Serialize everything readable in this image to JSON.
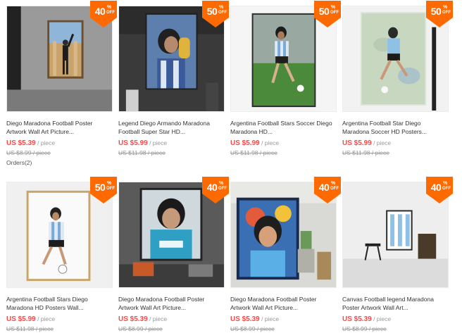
{
  "colors": {
    "accent": "#ff4747",
    "badge": "#ff6a00",
    "muted": "#999999"
  },
  "products": [
    {
      "discount": "40",
      "pct": "%",
      "off": "OFF",
      "title": "Diego Maradona Football Poster Artwork Wall Art Picture...",
      "price": "US $5.39",
      "unit": " / piece",
      "old_price": "US $8.99",
      "old_unit": " / piece",
      "orders": "Orders(2)"
    },
    {
      "discount": "50",
      "pct": "%",
      "off": "OFF",
      "title": "Legend Diego Armando Maradona Football Super Star HD...",
      "price": "US $5.99",
      "unit": " / piece",
      "old_price": "US $11.98",
      "old_unit": " / piece"
    },
    {
      "discount": "50",
      "pct": "%",
      "off": "OFF",
      "title": "Argentina Football Stars Soccer Diego Maradona HD...",
      "price": "US $5.99",
      "unit": " / piece",
      "old_price": "US $11.98",
      "old_unit": " / piece"
    },
    {
      "discount": "50",
      "pct": "%",
      "off": "OFF",
      "title": "Argentina Football Star Diego Maradona Soccer HD Posters...",
      "price": "US $5.99",
      "unit": " / piece",
      "old_price": "US $11.98",
      "old_unit": " / piece"
    },
    {
      "discount": "50",
      "pct": "%",
      "off": "OFF",
      "title": "Argentina Football Stars Diego Maradona HD Posters Wall...",
      "price": "US $5.99",
      "unit": " / piece",
      "old_price": "US $11.98",
      "old_unit": " / piece"
    },
    {
      "discount": "40",
      "pct": "%",
      "off": "OFF",
      "title": "Diego Maradona Football Poster Artwork Wall Art Picture...",
      "price": "US $5.39",
      "unit": " / piece",
      "old_price": "US $8.99",
      "old_unit": " / piece"
    },
    {
      "discount": "40",
      "pct": "%",
      "off": "OFF",
      "title": "Diego Maradona Football Poster Artwork Wall Art Picture...",
      "price": "US $5.39",
      "unit": " / piece",
      "old_price": "US $8.99",
      "old_unit": " / piece"
    },
    {
      "discount": "40",
      "pct": "%",
      "off": "OFF",
      "title": "Canvas Football legend Maradona Poster Artwork Wall Art...",
      "price": "US $5.39",
      "unit": " / piece",
      "old_price": "US $8.99",
      "old_unit": " / piece"
    }
  ]
}
